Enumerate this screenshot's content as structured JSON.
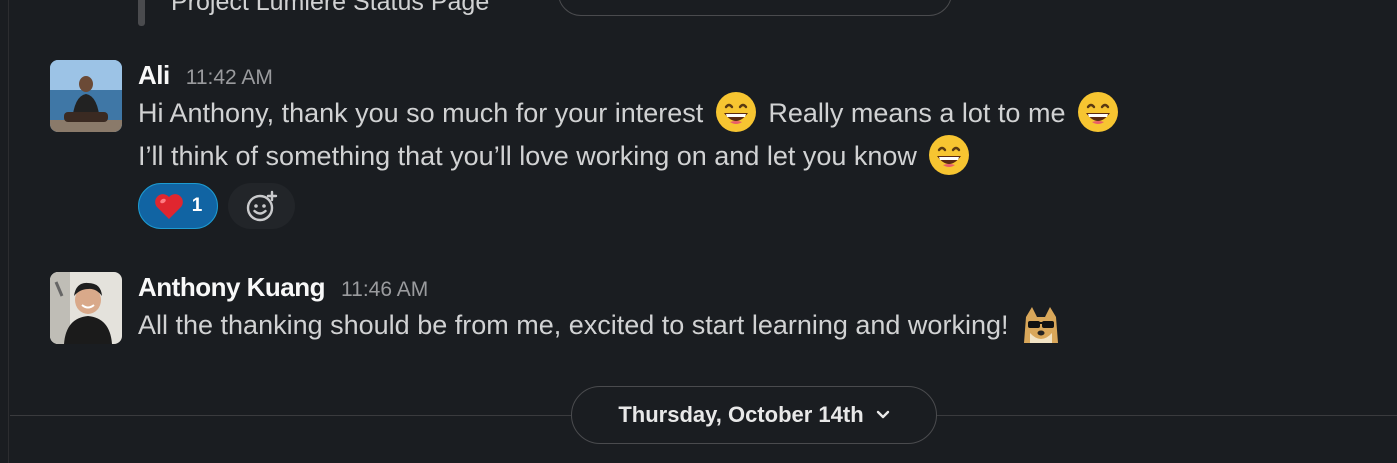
{
  "previous_attachment": {
    "title": "Project Lumiere Status Page"
  },
  "messages": [
    {
      "sender": "Ali",
      "time": "11:42 AM",
      "lines": {
        "l1_a": "Hi Anthony, thank you so much for your interest",
        "l1_b": "Really means a lot to me",
        "l2": "I’ll think of something that you’ll love working on and let you know"
      },
      "emoji": "grinning-face",
      "reactions": [
        {
          "emoji": "red-heart",
          "count": "1"
        }
      ]
    },
    {
      "sender": "Anthony Kuang",
      "time": "11:46 AM",
      "text": "All the thanking should be from me, excited to start learning and working!",
      "emoji": "doge-sunglasses"
    }
  ],
  "date_divider": {
    "label": "Thursday, October 14th"
  },
  "colors": {
    "background": "#1a1d21",
    "reaction_active": "#1164a3",
    "text": "#d1d2d3",
    "sender": "#f8f8f8",
    "timestamp": "#9a9b9e"
  }
}
